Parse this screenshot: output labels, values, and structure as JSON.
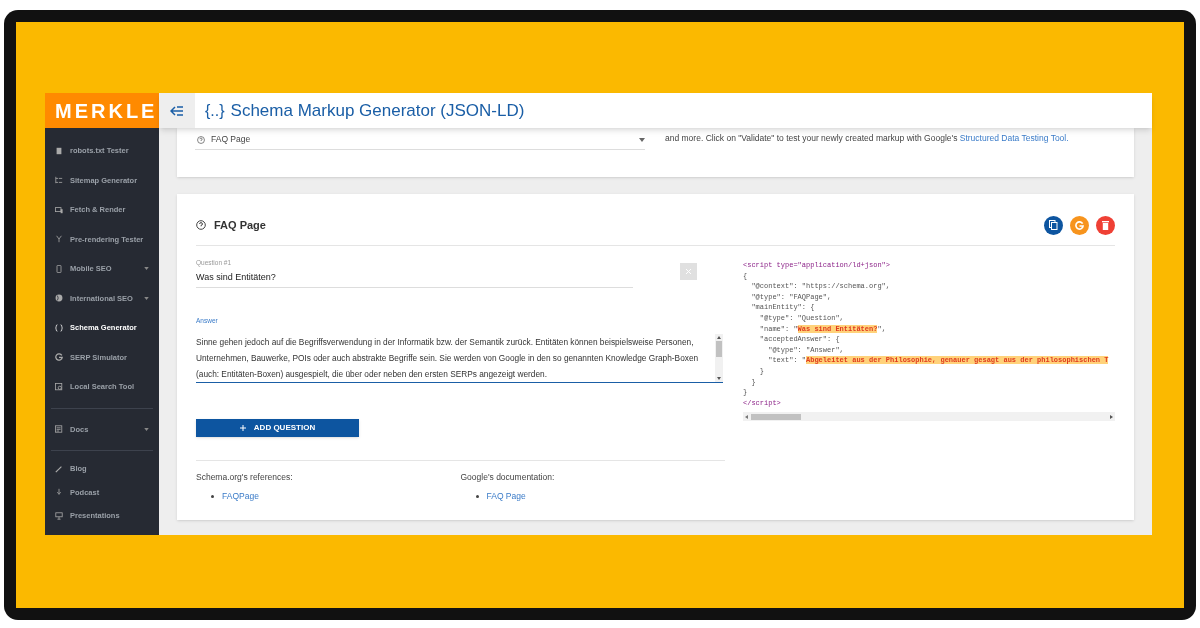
{
  "header": {
    "logo": "MERKLE",
    "title_icon": "{..}",
    "title": "Schema Markup Generator (JSON-LD)"
  },
  "sidebar": {
    "sections": [
      {
        "items": [
          {
            "label": "robots.txt Tester",
            "expandable": false,
            "selected": false
          },
          {
            "label": "Sitemap Generator",
            "expandable": false,
            "selected": false
          },
          {
            "label": "Fetch & Render",
            "expandable": false,
            "selected": false
          },
          {
            "label": "Pre-rendering Tester",
            "expandable": false,
            "selected": false
          },
          {
            "label": "Mobile SEO",
            "expandable": true,
            "selected": false
          },
          {
            "label": "International SEO",
            "expandable": true,
            "selected": false
          },
          {
            "label": "Schema Generator",
            "expandable": false,
            "selected": true
          },
          {
            "label": "SERP Simulator",
            "expandable": false,
            "selected": false
          },
          {
            "label": "Local Search Tool",
            "expandable": false,
            "selected": false
          }
        ]
      },
      {
        "items": [
          {
            "label": "Docs",
            "expandable": true,
            "selected": false
          }
        ]
      },
      {
        "items": [
          {
            "label": "Blog",
            "expandable": false,
            "selected": false
          },
          {
            "label": "Podcast",
            "expandable": false,
            "selected": false
          },
          {
            "label": "Presentations",
            "expandable": false,
            "selected": false
          }
        ]
      }
    ]
  },
  "type_card": {
    "select_value": "FAQ Page",
    "info_text": "and more. Click on \"Validate\" to test your newly created markup with Google's",
    "info_link": "Structured Data Testing Tool."
  },
  "faq_card": {
    "title": "FAQ Page",
    "questions": [
      {
        "label": "Question #1",
        "value": "Was sind Entitäten?",
        "answer_label": "Answer",
        "answer_lines": [
          "Sinne gehen jedoch auf die Begriffsverwendung in der Informatik bzw. der Semantik zurück. Entitäten können beispielsweise Personen,",
          "Unternehmen, Bauwerke, POIs oder auch abstrakte Begriffe sein. Sie werden von Google in den so genannten Knowledge Graph-Boxen",
          "(auch: Entitäten-Boxen) ausgespielt, die über oder neben den ersten SERPs angezeigt werden."
        ]
      }
    ],
    "add_button": "ADD QUESTION",
    "references": [
      {
        "heading": "Schema.org's references:",
        "links": [
          "FAQPage"
        ]
      },
      {
        "heading": "Google's documentation:",
        "links": [
          "FAQ Page"
        ]
      }
    ],
    "code_lines": [
      {
        "kind": "tag",
        "text": "<script type=\"application/ld+json\">"
      },
      {
        "kind": "plain",
        "text": "{"
      },
      {
        "kind": "plain",
        "text": "  \"@context\": \"https://schema.org\","
      },
      {
        "kind": "plain",
        "text": "  \"@type\": \"FAQPage\","
      },
      {
        "kind": "plain",
        "text": "  \"mainEntity\": {"
      },
      {
        "kind": "plain",
        "text": "    \"@type\": \"Question\","
      },
      {
        "kind": "highlight",
        "text": "    \"name\": \"",
        "highlight": "Was sind Entitäten?",
        "after": "\","
      },
      {
        "kind": "plain",
        "text": "    \"acceptedAnswer\": {"
      },
      {
        "kind": "plain",
        "text": "      \"@type\": \"Answer\","
      },
      {
        "kind": "highlight",
        "text": "      \"text\": \"",
        "highlight": "Abgeleitet aus der Philosophie, genauer gesagt aus der philosophischen T"
      },
      {
        "kind": "plain",
        "text": "    }"
      },
      {
        "kind": "plain",
        "text": "  }"
      },
      {
        "kind": "plain",
        "text": "}"
      },
      {
        "kind": "tag",
        "text": "</script>"
      }
    ]
  }
}
